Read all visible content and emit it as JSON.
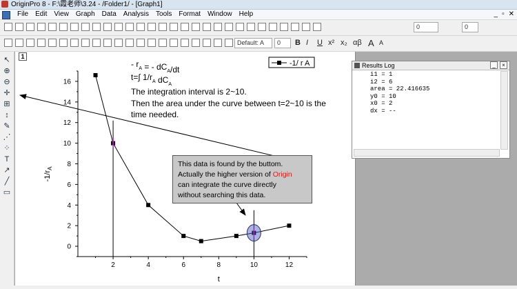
{
  "window": {
    "title": "OriginPro 8 - F:\\霞老师\\3.24 - /Folder1/ - [Graph1]"
  },
  "menu": {
    "items": [
      "File",
      "Edit",
      "View",
      "Graph",
      "Data",
      "Analysis",
      "Tools",
      "Format",
      "Window",
      "Help"
    ]
  },
  "toolbar": {
    "font_name": "Default: A",
    "font_size": "0",
    "line_width_value": "0",
    "fill_value": "0",
    "bold_label": "B",
    "italic_label": "I",
    "underline_label": "U",
    "superscript_label": "x²",
    "subscript_label": "x₂",
    "greek_label": "αβ",
    "font_up_label": "A",
    "font_down_label": "A"
  },
  "graph": {
    "layer_number": "1",
    "equation_line1": "- r",
    "equation_sub1": "A",
    "equation_line1_rest": " = - dC",
    "equation_sub2": "A",
    "equation_line1_end": "/dt",
    "equation_line2": "t=∫ 1/r",
    "equation_sub3": "A",
    "equation_line2_end": " dC",
    "equation_sub4": "A",
    "text_interval": "The integration interval is 2~10.",
    "text_area_1": "Then the area under the curve between t=2~10 is the",
    "text_area_2": "time needed.",
    "legend_label": "-1/ r A"
  },
  "chart_data": {
    "type": "line",
    "xlabel": "t",
    "ylabel": "-1/r",
    "ylabel_sub": "A",
    "xlim": [
      0,
      13
    ],
    "ylim": [
      -1,
      17
    ],
    "x_ticks": [
      2,
      4,
      6,
      8,
      10,
      12
    ],
    "y_ticks": [
      0,
      2,
      4,
      6,
      8,
      10,
      12,
      14,
      16
    ],
    "series": [
      {
        "name": "-1/ r A",
        "x": [
          1,
          2,
          4,
          6,
          7,
          9,
          10,
          12
        ],
        "y": [
          16.6,
          10,
          4,
          1,
          0.5,
          1,
          1.3,
          2
        ]
      }
    ],
    "vertical_lines": [
      2,
      10
    ]
  },
  "note": {
    "line1": "This data is found by the buttom.",
    "line2_a": "Actually the higher version of ",
    "line2_origin": "Origin",
    "line3": "can integrate the curve directly",
    "line4": "without searching this data."
  },
  "results_log": {
    "title": "Results Log",
    "lines": [
      "i1 = 1",
      "i2 = 6",
      "area = 22.416635",
      "y0 = 10",
      "x0 = 2",
      "dx = --"
    ]
  }
}
